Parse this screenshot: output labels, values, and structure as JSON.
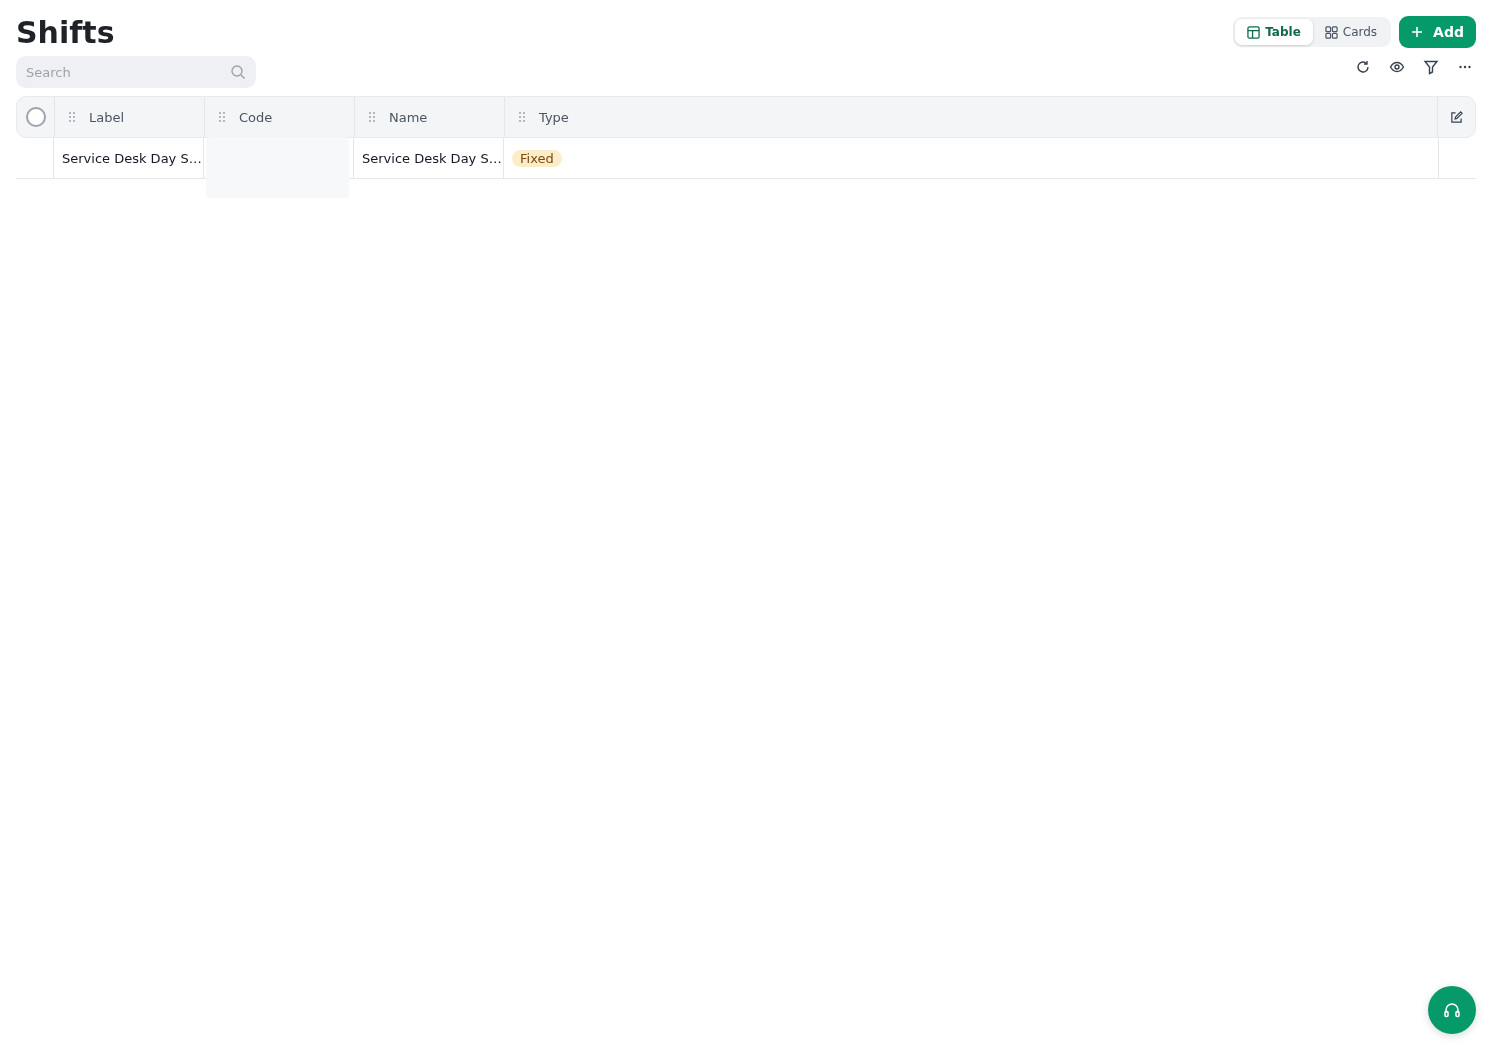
{
  "title": "Shifts",
  "search": {
    "placeholder": "Search"
  },
  "views": [
    {
      "label": "Table",
      "kind": "table",
      "selected": true
    },
    {
      "label": "Cards",
      "kind": "cards",
      "selected": false
    }
  ],
  "add_button": {
    "label": "Add"
  },
  "table": {
    "select_all": {
      "checked": false
    },
    "columns": [
      {
        "label": "Label"
      },
      {
        "label": "Code"
      },
      {
        "label": "Name"
      },
      {
        "label": "Type"
      }
    ],
    "rows": [
      {
        "cells": [
          {
            "kind": "text",
            "text": "Service Desk Day S…"
          },
          {
            "kind": "text",
            "text": ""
          },
          {
            "kind": "text",
            "text": "Service Desk Day S…"
          },
          {
            "kind": "tag",
            "text": "Fixed"
          }
        ]
      }
    ]
  }
}
